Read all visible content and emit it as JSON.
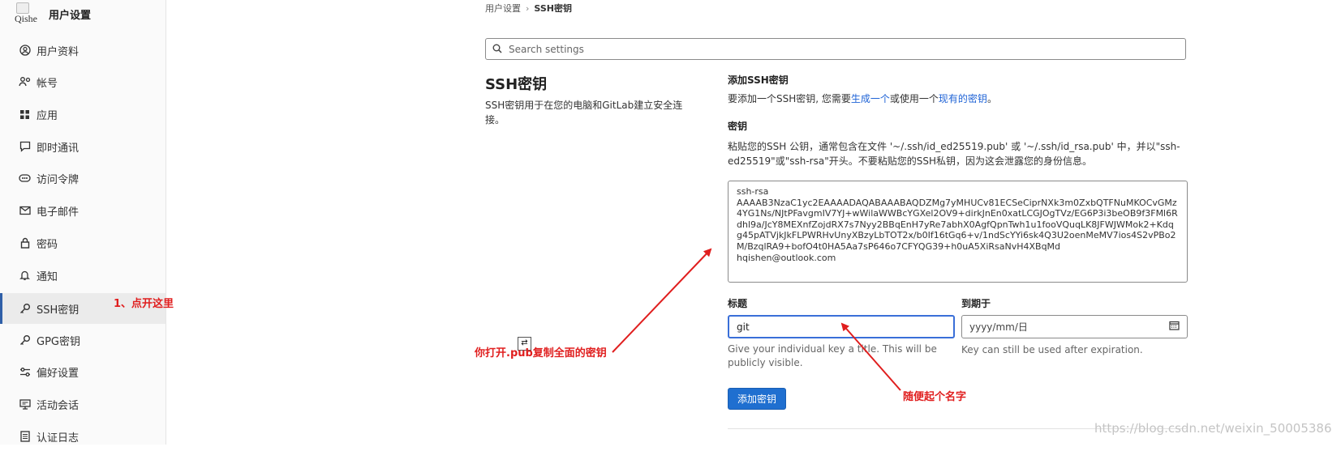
{
  "sidebar": {
    "avatar_text": "Qishe",
    "title": "用户设置",
    "items": [
      {
        "label": "用户资料",
        "icon": "user-circle-icon"
      },
      {
        "label": "帐号",
        "icon": "user-gear-icon"
      },
      {
        "label": "应用",
        "icon": "grid-icon"
      },
      {
        "label": "即时通讯",
        "icon": "chat-icon"
      },
      {
        "label": "访问令牌",
        "icon": "token-icon"
      },
      {
        "label": "电子邮件",
        "icon": "mail-icon"
      },
      {
        "label": "密码",
        "icon": "lock-icon"
      },
      {
        "label": "通知",
        "icon": "bell-icon"
      },
      {
        "label": "SSH密钥",
        "icon": "key-icon",
        "active": true
      },
      {
        "label": "GPG密钥",
        "icon": "key-icon"
      },
      {
        "label": "偏好设置",
        "icon": "sliders-icon"
      },
      {
        "label": "活动会话",
        "icon": "monitor-icon"
      },
      {
        "label": "认证日志",
        "icon": "log-icon"
      }
    ]
  },
  "breadcrumb": {
    "parent": "用户设置",
    "current": "SSH密钥"
  },
  "search": {
    "placeholder": "Search settings"
  },
  "section": {
    "title": "SSH密钥",
    "description": "SSH密钥用于在您的电脑和GitLab建立安全连接。"
  },
  "form": {
    "add_heading": "添加SSH密钥",
    "add_intro_prefix": "要添加一个SSH密钥, 您需要",
    "add_intro_link1": "生成一个",
    "add_intro_middle": "或使用一个",
    "add_intro_link2": "现有的密钥",
    "add_intro_suffix": "。",
    "key_heading": "密钥",
    "key_help": "粘贴您的SSH 公钥，通常包含在文件 '~/.ssh/id_ed25519.pub' 或 '~/.ssh/id_rsa.pub' 中，并以\"ssh-ed25519\"或\"ssh-rsa\"开头。不要粘贴您的SSH私钥，因为这会泄露您的身份信息。",
    "key_value": "ssh-rsa\nAAAAB3NzaC1yc2EAAAADAQABAAABAQDZMg7yMHUCv81ECSeCiprNXk3m0ZxbQTFNuMKOCvGMz4YG1Ns/NJtPFavgmIV7YJ+wWilaWWBcYGXel2OV9+dirkJnEn0xatLCGJOgTVz/EG6P3i3beOB9f3FMl6Rdhl9a/JcY8MEXnfZojdRX7s7Nyy2BBqEnH7yRe7abhX0AgfQpnTwh1u1fooVQuqLK8JFWJWMok2+Kdqg45pATVjkJkFLPWRHvUnyXBzyLbTOT2x/b0If16tGq6+v/1ndScYYi6sk4Q3U2oenMeMV7ios4S2vPBo2M/BzqlRA9+bofO4t0HA5Aa7sP646o7CFYQG39+h0uA5XiRsaNvH4XBqMd\nhqishen@outlook.com",
    "title_label": "标题",
    "title_value": "git",
    "title_hint": "Give your individual key a title. This will be publicly visible.",
    "expires_label": "到期于",
    "expires_placeholder": "yyyy/mm/日",
    "expires_hint": "Key can still be used after expiration.",
    "submit_label": "添加密钥"
  },
  "annotations": {
    "note1": "1、点开这里",
    "note2": "你打开.pub复制全面的密钥",
    "note3": "随便起个名字",
    "annotation_color": "#e01e1e"
  },
  "watermark": "https://blog.csdn.net/weixin_50005386",
  "colors": {
    "accent": "#1f6fd0",
    "link": "#1f63d6",
    "active_bar": "#2f5fa8"
  }
}
